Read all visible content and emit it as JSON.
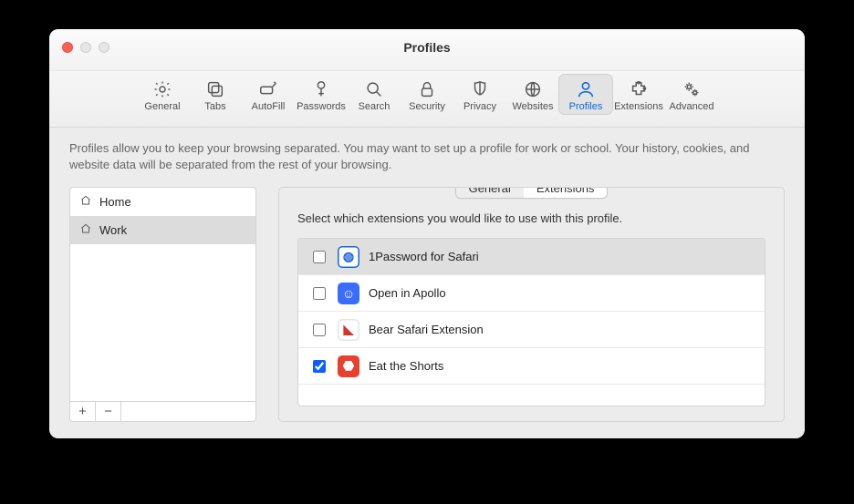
{
  "window": {
    "title": "Profiles"
  },
  "toolbar": [
    {
      "id": "general",
      "label": "General"
    },
    {
      "id": "tabs",
      "label": "Tabs"
    },
    {
      "id": "autofill",
      "label": "AutoFill"
    },
    {
      "id": "passwords",
      "label": "Passwords"
    },
    {
      "id": "search",
      "label": "Search"
    },
    {
      "id": "security",
      "label": "Security"
    },
    {
      "id": "privacy",
      "label": "Privacy"
    },
    {
      "id": "websites",
      "label": "Websites"
    },
    {
      "id": "profiles",
      "label": "Profiles",
      "active": true
    },
    {
      "id": "extensions",
      "label": "Extensions"
    },
    {
      "id": "advanced",
      "label": "Advanced"
    }
  ],
  "description": "Profiles allow you to keep your browsing separated. You may want to set up a profile for work or school. Your history, cookies, and website data will be separated from the rest of your browsing.",
  "profiles": [
    {
      "name": "Home",
      "icon": "house",
      "selected": false
    },
    {
      "name": "Work",
      "icon": "house",
      "selected": true
    }
  ],
  "segments": [
    {
      "label": "General",
      "active": false
    },
    {
      "label": "Extensions",
      "active": true
    }
  ],
  "panel_hint": "Select which extensions you would like to use with this profile.",
  "extensions": [
    {
      "name": "1Password for Safari",
      "checked": false,
      "selected": true,
      "icon": {
        "bg": "#ffffff",
        "glyph": "◍",
        "fg": "#1a65d6",
        "ring": "#1a65d6"
      }
    },
    {
      "name": "Open in Apollo",
      "checked": false,
      "selected": false,
      "icon": {
        "bg": "#3a6cff",
        "glyph": "☺",
        "fg": "#ffffff"
      }
    },
    {
      "name": "Bear Safari Extension",
      "checked": false,
      "selected": false,
      "icon": {
        "bg": "#ffffff",
        "glyph": "◣",
        "fg": "#d5352b",
        "ring": "#e4e4e4"
      }
    },
    {
      "name": "Eat the Shorts",
      "checked": true,
      "selected": false,
      "icon": {
        "bg": "#e7402f",
        "glyph": "⬣",
        "fg": "#ffffff"
      }
    }
  ],
  "buttons": {
    "add": "+",
    "remove": "−"
  }
}
